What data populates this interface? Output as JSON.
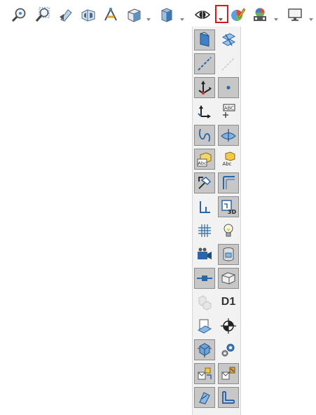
{
  "toolbar": {
    "items": [
      {
        "name": "zoom-to-fit-icon"
      },
      {
        "name": "zoom-to-area-icon"
      },
      {
        "name": "previous-view-icon"
      },
      {
        "name": "section-view-icon"
      },
      {
        "name": "dynamic-annotation-icon"
      },
      {
        "name": "view-orientation-icon",
        "has_dropdown": true
      },
      {
        "name": "display-style-icon",
        "has_dropdown": true
      },
      {
        "name": "hide-show-items-icon",
        "has_dropdown": true,
        "dropdown_highlighted": true
      },
      {
        "name": "edit-appearance-icon"
      },
      {
        "name": "apply-scene-icon",
        "has_dropdown": true
      },
      {
        "name": "view-settings-icon",
        "has_dropdown": true
      }
    ],
    "highlight_color": "#d31a1a"
  },
  "flyout": {
    "rows": [
      [
        {
          "name": "view-planes-icon",
          "pressed": true
        },
        {
          "name": "view-sketch-planes-icon",
          "pressed": false
        }
      ],
      [
        {
          "name": "view-axes-icon",
          "pressed": true
        },
        {
          "name": "view-temporary-axes-icon",
          "pressed": false,
          "disabled": true
        }
      ],
      [
        {
          "name": "view-origins-icon",
          "pressed": true
        },
        {
          "name": "view-points-icon",
          "pressed": true
        }
      ],
      [
        {
          "name": "view-coordinate-systems-icon",
          "pressed": false
        },
        {
          "name": "view-annotations-icon",
          "pressed": false
        }
      ],
      [
        {
          "name": "view-curves-icon",
          "pressed": true
        },
        {
          "name": "view-surfaces-icon",
          "pressed": true
        }
      ],
      [
        {
          "name": "view-sketch-dimensions-icon",
          "pressed": true
        },
        {
          "name": "view-sketch-relations-icon",
          "pressed": false
        }
      ],
      [
        {
          "name": "view-sketch-icon",
          "pressed": true
        },
        {
          "name": "view-routing-points-icon",
          "pressed": true
        }
      ],
      [
        {
          "name": "view-dimension-names-icon",
          "pressed": false
        },
        {
          "name": "view-3d-sketch-planes-icon",
          "pressed": true
        }
      ],
      [
        {
          "name": "view-grid-icon",
          "pressed": false
        },
        {
          "name": "view-lights-icon",
          "pressed": false
        }
      ],
      [
        {
          "name": "view-cameras-icon",
          "pressed": false
        },
        {
          "name": "view-decals-icon",
          "pressed": true
        }
      ],
      [
        {
          "name": "view-parting-lines-icon",
          "pressed": true
        },
        {
          "name": "view-bounding-box-icon",
          "pressed": true
        }
      ],
      [
        {
          "name": "view-weld-beads-icon",
          "pressed": false,
          "disabled": true
        },
        {
          "name": "view-dimension-names-text",
          "pressed": false,
          "label": "D1"
        }
      ],
      [
        {
          "name": "view-live-section-planes-icon",
          "pressed": false
        },
        {
          "name": "view-center-of-mass-icon",
          "pressed": false
        }
      ],
      [
        {
          "name": "view-mates-icon",
          "pressed": true
        },
        {
          "name": "view-mate-references-icon",
          "pressed": false
        }
      ],
      [
        {
          "name": "view-routing-connections-icon",
          "pressed": true
        },
        {
          "name": "view-routing-mates-icon",
          "pressed": true
        }
      ],
      [
        {
          "name": "view-sketch-patterns-icon",
          "pressed": true
        },
        {
          "name": "view-sheet-metal-icon",
          "pressed": true
        }
      ]
    ]
  }
}
